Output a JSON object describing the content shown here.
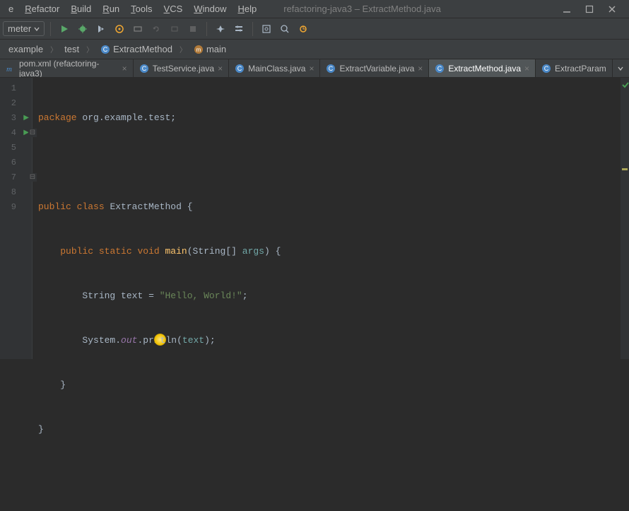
{
  "menubar": {
    "items": [
      {
        "label": "e",
        "mnemonic": ""
      },
      {
        "label": "efactor",
        "mnemonic": "R"
      },
      {
        "label": "uild",
        "mnemonic": "B"
      },
      {
        "label": "un",
        "mnemonic": "R"
      },
      {
        "label": "ools",
        "mnemonic": "T"
      },
      {
        "label": "CS",
        "mnemonic": "V"
      },
      {
        "label": "indow",
        "mnemonic": "W"
      },
      {
        "label": "elp",
        "mnemonic": "H"
      }
    ],
    "title": "refactoring-java3 – ExtractMethod.java"
  },
  "toolbar": {
    "run_config_label": "meter"
  },
  "breadcrumbs": {
    "items": [
      {
        "label": "example",
        "icon": "folder"
      },
      {
        "label": "test",
        "icon": "folder"
      },
      {
        "label": "ExtractMethod",
        "icon": "class"
      },
      {
        "label": "main",
        "icon": "method"
      }
    ]
  },
  "tabs": {
    "items": [
      {
        "label": "pom.xml (refactoring-java3)",
        "icon": "maven",
        "active": false
      },
      {
        "label": "TestService.java",
        "icon": "class",
        "active": false
      },
      {
        "label": "MainClass.java",
        "icon": "class",
        "active": false
      },
      {
        "label": "ExtractVariable.java",
        "icon": "class",
        "active": false
      },
      {
        "label": "ExtractMethod.java",
        "icon": "class",
        "active": true
      },
      {
        "label": "ExtractParam",
        "icon": "class",
        "active": false
      }
    ]
  },
  "code": {
    "lines": [
      {
        "n": "1"
      },
      {
        "n": "2"
      },
      {
        "n": "3"
      },
      {
        "n": "4"
      },
      {
        "n": "5"
      },
      {
        "n": "6"
      },
      {
        "n": "7"
      },
      {
        "n": "8"
      },
      {
        "n": "9"
      }
    ],
    "tokens": {
      "package": "package",
      "pkgname": "org.example.test",
      "public": "public",
      "class": "class",
      "className": "ExtractMethod",
      "static": "static",
      "void": "void",
      "main": "main",
      "string_arr": "String[]",
      "args": "args",
      "string_t": "String",
      "text_var": "text",
      "eq": "=",
      "hello": "\"Hello, World!\"",
      "system": "System",
      "out": "out",
      "println_a": "pri",
      "println_b": "tln",
      "text_ref": "text",
      "semi": ";",
      "lbrace": "{",
      "rbrace": "}",
      "lparen": "(",
      "rparen": ")",
      "dot": "."
    }
  }
}
